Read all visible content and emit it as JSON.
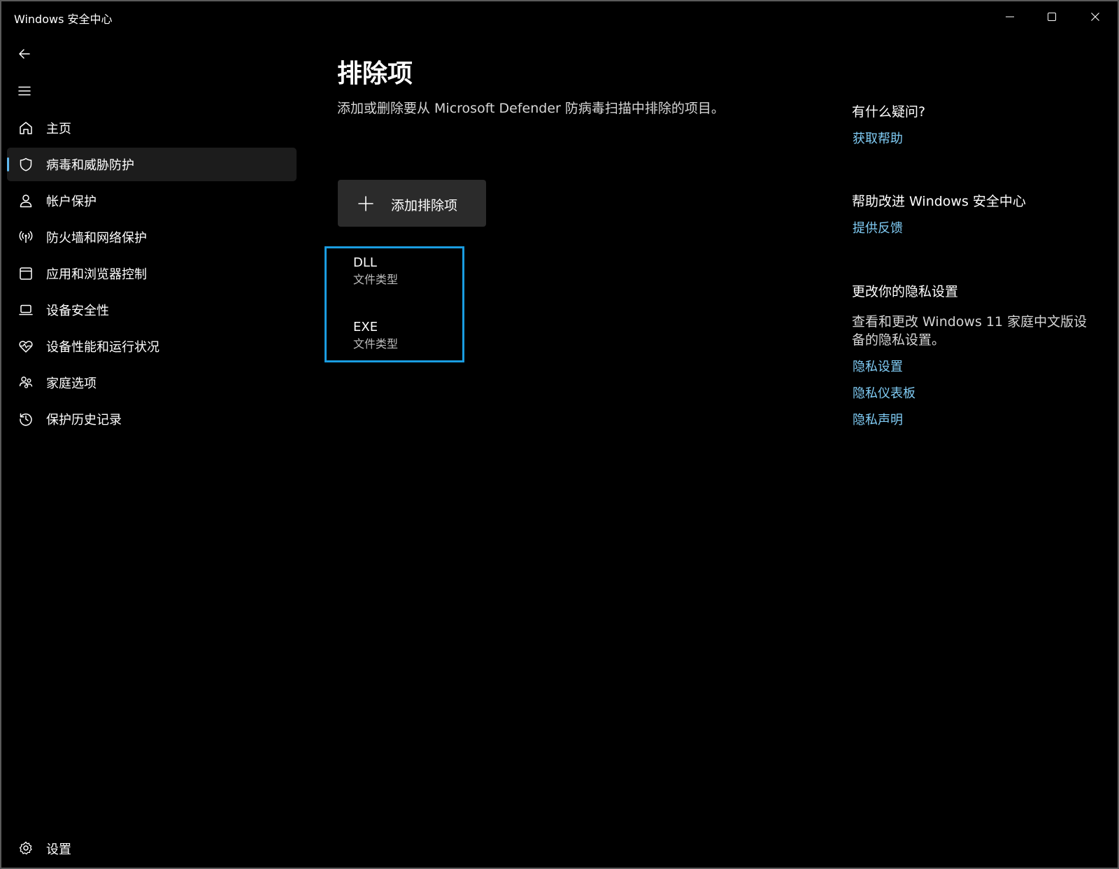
{
  "window": {
    "title": "Windows 安全中心",
    "controls": [
      "minimize-icon",
      "maximize-icon",
      "close-icon"
    ]
  },
  "nav": {
    "items": [
      {
        "label": "主页",
        "icon": "home-icon"
      },
      {
        "label": "病毒和威胁防护",
        "icon": "shield-icon",
        "selected": true
      },
      {
        "label": "帐户保护",
        "icon": "person-icon"
      },
      {
        "label": "防火墙和网络保护",
        "icon": "wifi-signal-icon"
      },
      {
        "label": "应用和浏览器控制",
        "icon": "app-window-icon"
      },
      {
        "label": "设备安全性",
        "icon": "laptop-icon"
      },
      {
        "label": "设备性能和运行状况",
        "icon": "heart-pulse-icon"
      },
      {
        "label": "家庭选项",
        "icon": "family-icon"
      },
      {
        "label": "保护历史记录",
        "icon": "history-icon"
      }
    ],
    "settings_label": "设置"
  },
  "main": {
    "title": "排除项",
    "description": "添加或删除要从 Microsoft Defender 防病毒扫描中排除的项目。",
    "add_button_label": "添加排除项",
    "exclusions": [
      {
        "name": "DLL",
        "type": "文件类型"
      },
      {
        "name": "EXE",
        "type": "文件类型"
      }
    ]
  },
  "side": {
    "help_heading": "有什么疑问?",
    "help_link": "获取帮助",
    "improve_heading": "帮助改进 Windows 安全中心",
    "feedback_link": "提供反馈",
    "privacy_heading": "更改你的隐私设置",
    "privacy_text": "查看和更改 Windows 11 家庭中文版设备的隐私设置。",
    "privacy_links": [
      "隐私设置",
      "隐私仪表板",
      "隐私声明"
    ]
  },
  "colors": {
    "accent": "#60b9f0",
    "link": "#80ccf5",
    "focus_border": "#1a9ce0",
    "button_bg": "#2b2b2b",
    "selected_bg": "#1c1c1c"
  }
}
